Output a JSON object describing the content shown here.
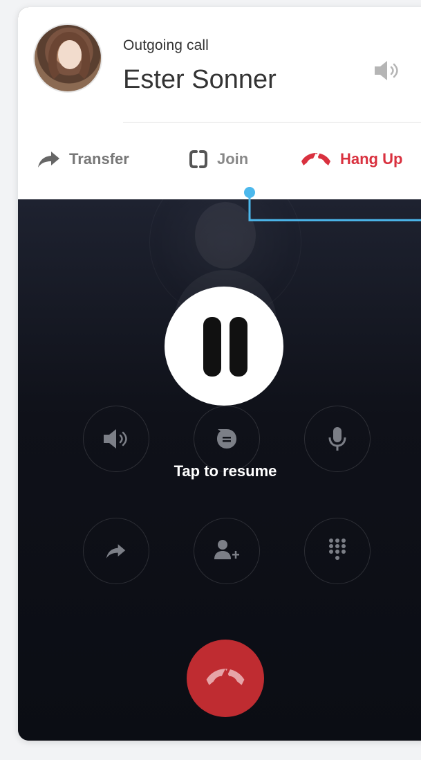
{
  "header": {
    "call_label": "Outgoing call",
    "caller_name": "Ester Sonner"
  },
  "actions": {
    "transfer": "Transfer",
    "join": "Join",
    "hang_up": "Hang Up"
  },
  "overlay": {
    "tap_label": "Tap to resume"
  },
  "icons": {
    "speaker": "speaker-icon",
    "transfer": "share-arrow-icon",
    "join": "join-brackets-icon",
    "hangup": "hangup-icon",
    "pause": "pause-icon",
    "speaker_ctrl": "speaker-icon",
    "message": "message-icon",
    "microphone": "microphone-icon",
    "add_person": "add-person-icon",
    "keypad": "keypad-icon"
  },
  "colors": {
    "accent_red": "#d9313f",
    "end_call_red": "#bf2c31",
    "pointer_blue": "#4cb8ec",
    "dark_bg": "#0f1119"
  }
}
